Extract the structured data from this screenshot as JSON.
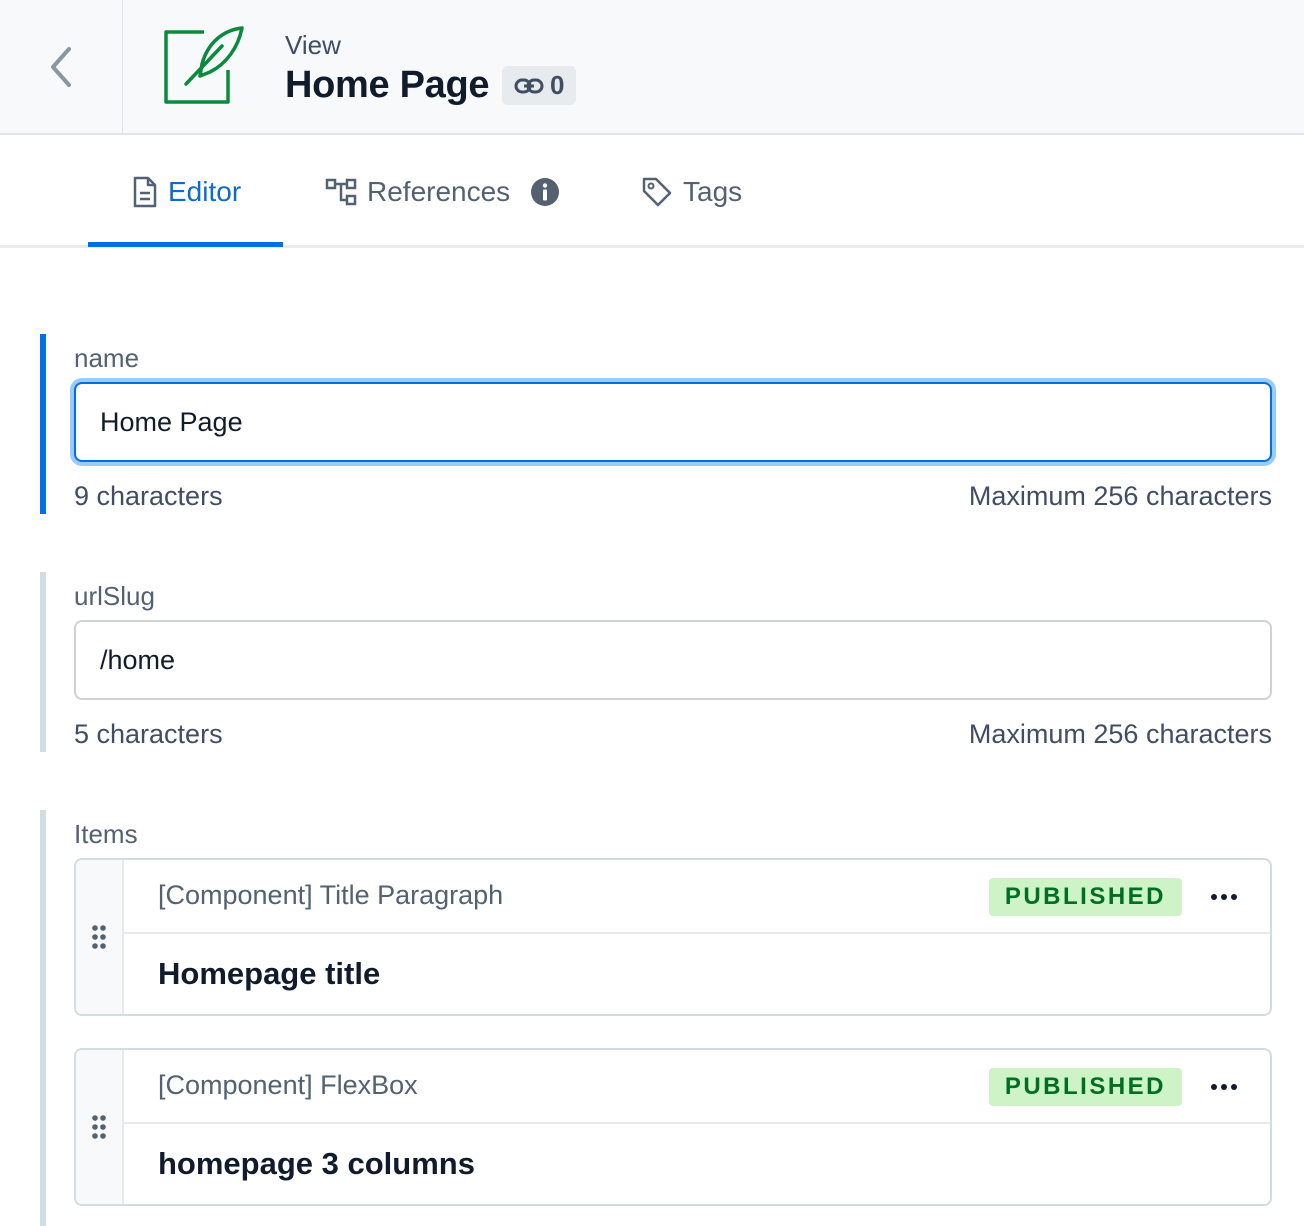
{
  "header": {
    "view_label": "View",
    "title": "Home Page",
    "reference_count": "0",
    "entity_icon": "feather-edit-icon",
    "back_icon": "chevron-left-icon"
  },
  "tabs": [
    {
      "label": "Editor",
      "icon": "document-icon",
      "active": true
    },
    {
      "label": "References",
      "icon": "hierarchy-icon",
      "active": false,
      "has_info": true
    },
    {
      "label": "Tags",
      "icon": "tag-icon",
      "active": false
    }
  ],
  "fields": {
    "name": {
      "label": "name",
      "value": "Home Page",
      "char_count": "9 characters",
      "max": "Maximum 256 characters"
    },
    "url_slug": {
      "label": "urlSlug",
      "value": "/home",
      "char_count": "5 characters",
      "max": "Maximum 256 characters"
    }
  },
  "items": {
    "label": "Items",
    "entries": [
      {
        "type": "[Component] Title Paragraph",
        "status": "PUBLISHED",
        "title": "Homepage title"
      },
      {
        "type": "[Component] FlexBox",
        "status": "PUBLISHED",
        "title": "homepage 3 columns"
      }
    ]
  },
  "colors": {
    "accent": "#036fe3",
    "published_bg": "#cdf3c6",
    "published_text": "#006f23",
    "entity_icon": "#0b8a3e"
  }
}
